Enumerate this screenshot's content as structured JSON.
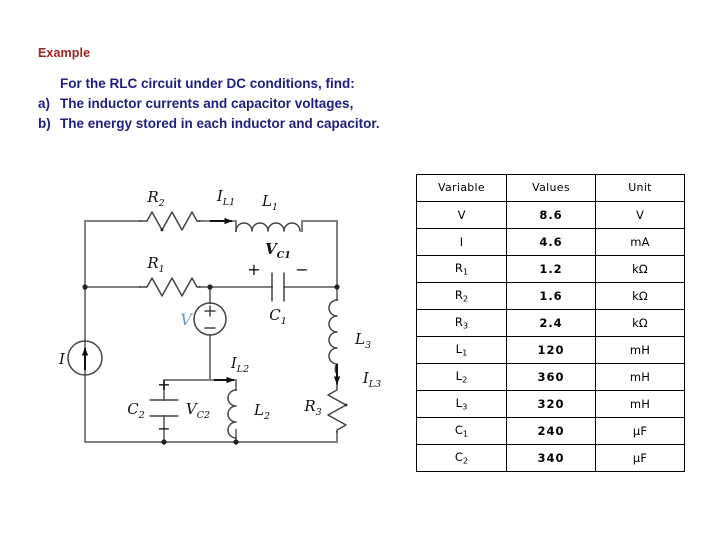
{
  "slide": {
    "heading": "Example",
    "heading_color": "#A32222",
    "body_color": "#1F2080",
    "body_lines": [
      {
        "marker": "",
        "text": "For the RLC circuit under DC conditions, find:"
      },
      {
        "marker": "a)",
        "text": "The inductor currents and capacitor voltages,"
      },
      {
        "marker": "b)",
        "text": "The energy stored in each inductor and capacitor."
      }
    ]
  },
  "table": {
    "headers": [
      "Variable",
      "Values",
      "Unit"
    ],
    "rows": [
      {
        "variable": "V",
        "sub": "",
        "value": "8.6",
        "unit": "V"
      },
      {
        "variable": "I",
        "sub": "",
        "value": "4.6",
        "unit": "mA"
      },
      {
        "variable": "R",
        "sub": "1",
        "value": "1.2",
        "unit": "kΩ"
      },
      {
        "variable": "R",
        "sub": "2",
        "value": "1.6",
        "unit": "kΩ"
      },
      {
        "variable": "R",
        "sub": "3",
        "value": "2.4",
        "unit": "kΩ"
      },
      {
        "variable": "L",
        "sub": "1",
        "value": "120",
        "unit": "mH"
      },
      {
        "variable": "L",
        "sub": "2",
        "value": "360",
        "unit": "mH"
      },
      {
        "variable": "L",
        "sub": "3",
        "value": "320",
        "unit": "mH"
      },
      {
        "variable": "C",
        "sub": "1",
        "value": "240",
        "unit": "μF"
      },
      {
        "variable": "C",
        "sub": "2",
        "value": "340",
        "unit": "μF"
      }
    ]
  },
  "circuit": {
    "wire_color": "#808080",
    "component_color": "#333333",
    "label_color": "#000000",
    "source_label_color": "#7FA8C9",
    "labels": {
      "r1": "R",
      "r1_sub": "1",
      "r2": "R",
      "r2_sub": "2",
      "r3": "R",
      "r3_sub": "3",
      "l1": "L",
      "l1_sub": "1",
      "l2": "L",
      "l2_sub": "2",
      "l3": "L",
      "l3_sub": "3",
      "c1": "C",
      "c1_sub": "1",
      "c2": "C",
      "c2_sub": "2",
      "vsource": "V",
      "isource": "I",
      "i_l1": "I",
      "i_l1_sub": "L1",
      "i_l2": "I",
      "i_l2_sub": "L2",
      "i_l3": "I",
      "i_l3_sub": "L3",
      "v_c1": "V",
      "v_c1_sub": "C1",
      "v_c2": "V",
      "v_c2_sub": "C2",
      "plus": "+",
      "minus": "−"
    }
  }
}
